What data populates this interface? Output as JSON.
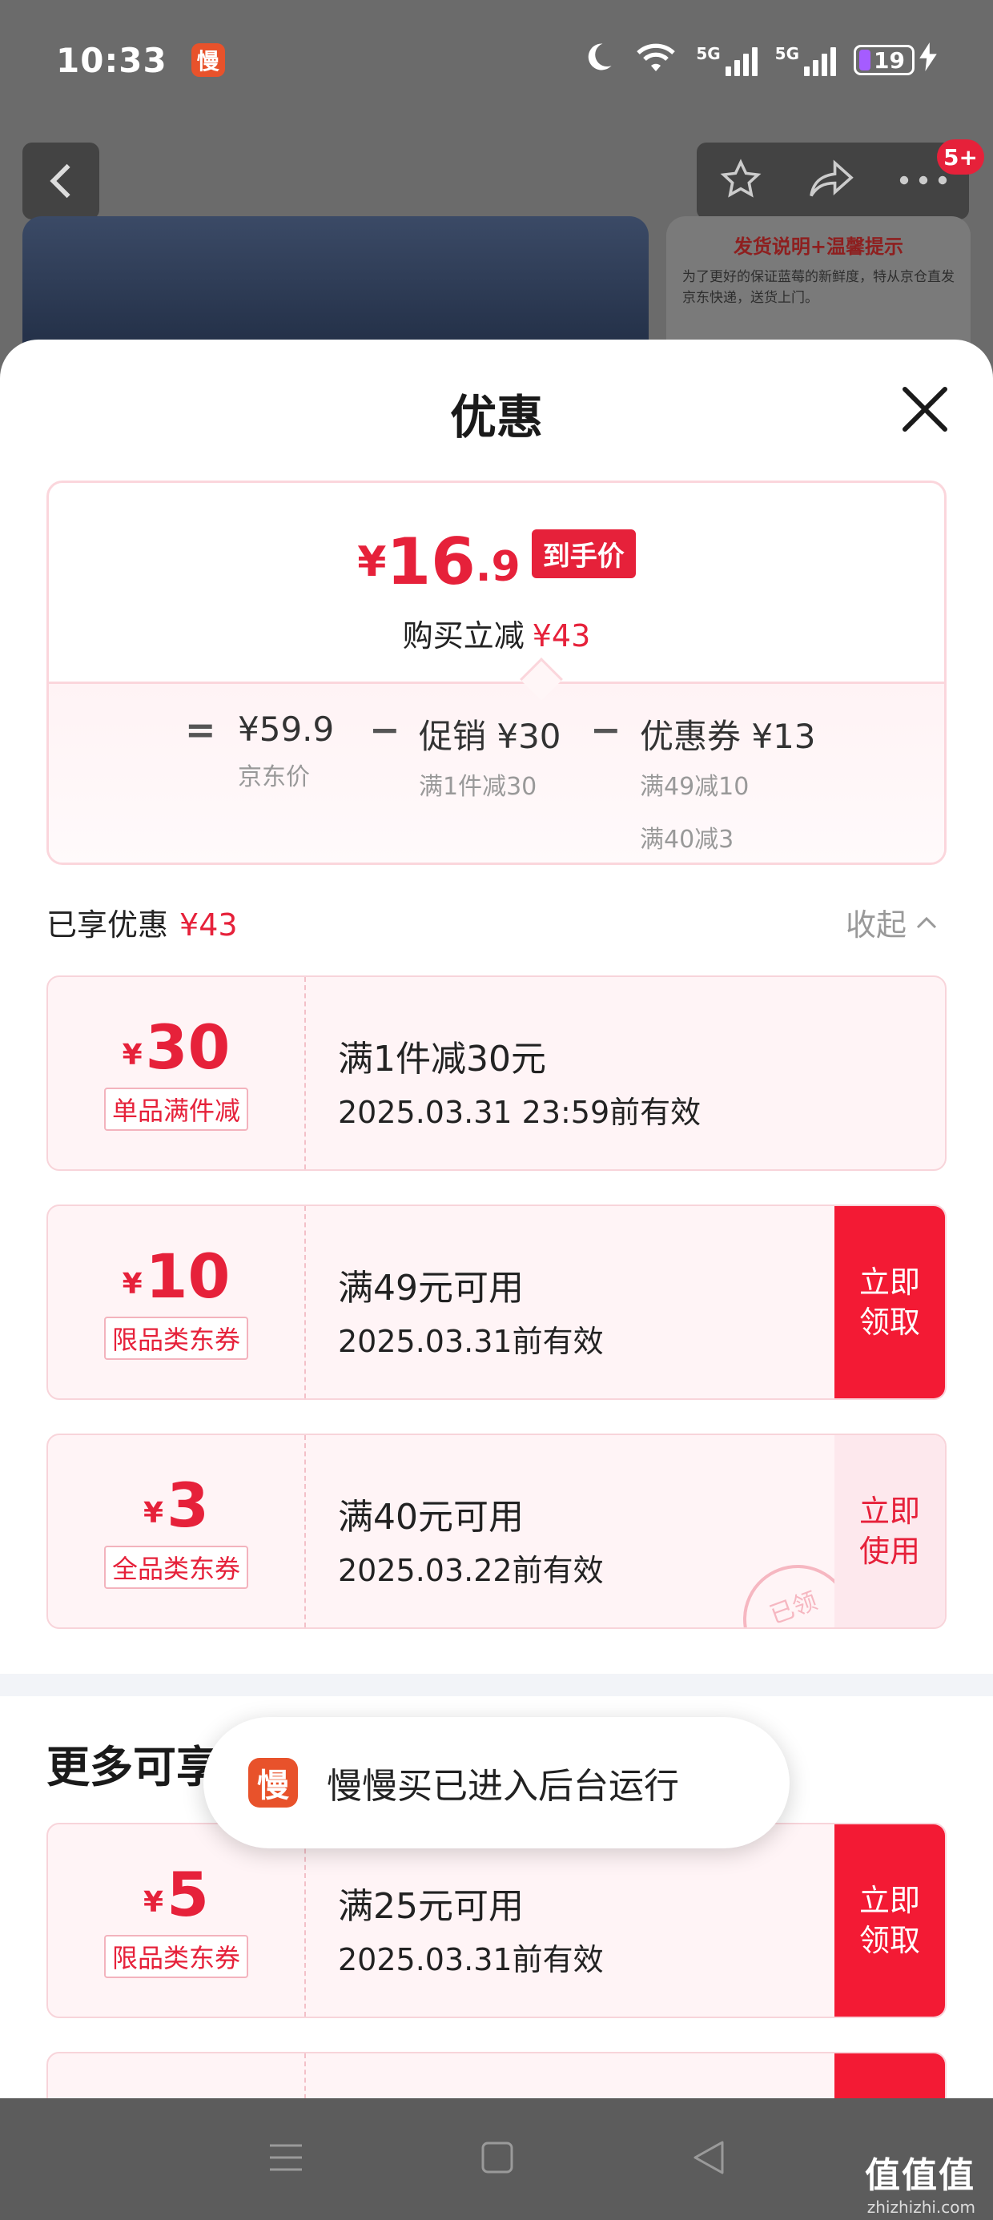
{
  "status_bar": {
    "time": "10:33",
    "app_icon": "慢",
    "network1": "5G",
    "network2": "5G",
    "battery": "19"
  },
  "nav": {
    "badge": "5+"
  },
  "bg_info": {
    "title": "发货说明+温馨提示",
    "text": "为了更好的保证蓝莓的新鲜度，特从京仓直发京东快递，送货上门。"
  },
  "sheet": {
    "title": "优惠",
    "summary": {
      "price_yen": "¥",
      "price_int": "16",
      "price_dec": ".9",
      "price_tag": "到手价",
      "discount_label": "购买立减",
      "discount_value": "¥43",
      "equals": "=",
      "minus": "−",
      "jd_price": "¥59.9",
      "jd_price_label": "京东价",
      "promo": "促销 ¥30",
      "promo_desc": "满1件减30",
      "coupon": "优惠券 ¥13",
      "coupon_desc1": "满49减10",
      "coupon_desc2": "满40减3"
    },
    "enjoyed_label": "已享优惠",
    "enjoyed_value": "¥43",
    "collapse_label": "收起",
    "coupons": [
      {
        "yen": "¥",
        "amount": "30",
        "tag": "单品满件减",
        "cond": "满1件减30元",
        "valid": "2025.03.31 23:59前有效"
      },
      {
        "yen": "¥",
        "amount": "10",
        "tag": "限品类东券",
        "cond": "满49元可用",
        "valid": "2025.03.31前有效",
        "btn": "立即领取"
      },
      {
        "yen": "¥",
        "amount": "3",
        "tag": "全品类东券",
        "cond": "满40元可用",
        "valid": "2025.03.22前有效",
        "btn": "立即使用",
        "stamp": "已领"
      }
    ],
    "more_title": "更多可享",
    "more_coupons": [
      {
        "yen": "¥",
        "amount": "5",
        "tag": "限品类东券",
        "cond": "满25元可用",
        "valid": "2025.03.31前有效",
        "btn": "立即领取"
      }
    ]
  },
  "toast": {
    "icon": "慢",
    "text": "慢慢买已进入后台运行"
  },
  "watermark": {
    "main": "值值值",
    "sub": "zhizhizhi.com"
  }
}
